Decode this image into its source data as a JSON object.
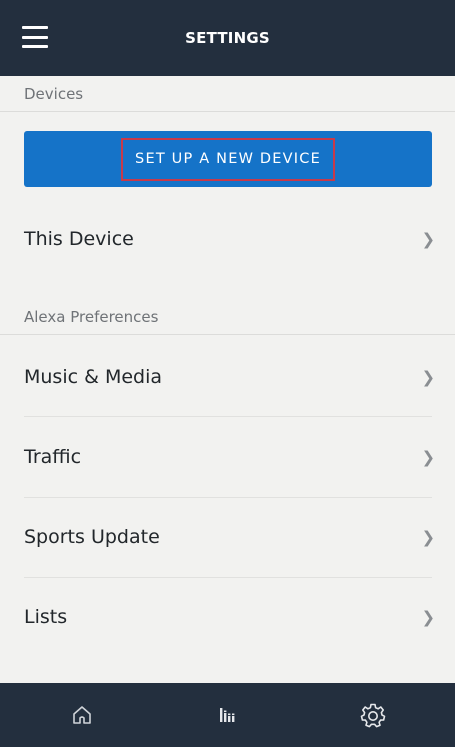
{
  "header": {
    "title": "SETTINGS",
    "menu_icon": "hamburger-menu-icon"
  },
  "sections": {
    "devices": {
      "label": "Devices",
      "cta_label": "SET UP A NEW DEVICE",
      "items": [
        {
          "label": "This Device"
        }
      ]
    },
    "alexa_preferences": {
      "label": "Alexa Preferences",
      "items": [
        {
          "label": "Music & Media"
        },
        {
          "label": "Traffic"
        },
        {
          "label": "Sports Update"
        },
        {
          "label": "Lists"
        }
      ]
    }
  },
  "bottom_nav": {
    "tabs": [
      {
        "icon": "home-icon"
      },
      {
        "icon": "equalizer-icon"
      },
      {
        "icon": "gear-icon"
      }
    ]
  },
  "colors": {
    "header_bg": "#232f3e",
    "accent": "#1573c8",
    "highlight_border": "#c73a4a",
    "page_bg": "#f2f2f0"
  }
}
